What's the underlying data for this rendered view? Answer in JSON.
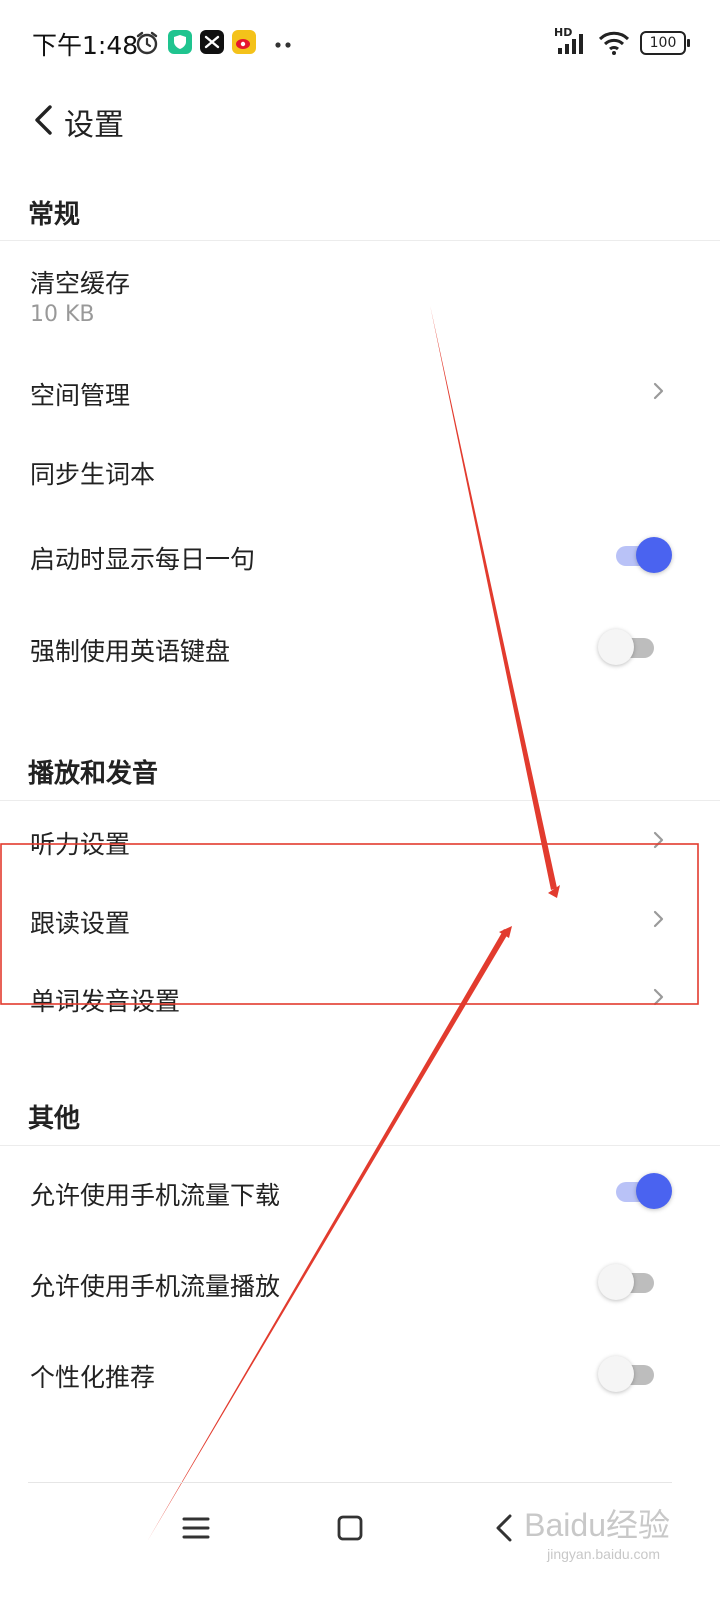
{
  "status_bar": {
    "time": "下午1:48",
    "app_icons": [
      "alarm-icon",
      "shield-app-icon",
      "capcut-app-icon",
      "weibo-app-icon",
      "more-dots-icon"
    ],
    "signal_label": "HD",
    "battery": "100"
  },
  "header": {
    "title": "设置"
  },
  "sections": {
    "general": {
      "title": "常规",
      "clear_cache": {
        "label": "清空缓存",
        "value": "10 KB"
      },
      "space_manage": {
        "label": "空间管理"
      },
      "sync_vocab": {
        "label": "同步生词本"
      },
      "daily_sentence": {
        "label": "启动时显示每日一句",
        "enabled": true
      },
      "force_english_keyboard": {
        "label": "强制使用英语键盘",
        "enabled": false
      }
    },
    "playback": {
      "title": "播放和发音",
      "listening": {
        "label": "听力设置"
      },
      "follow_read": {
        "label": "跟读设置"
      },
      "word_pronunciation": {
        "label": "单词发音设置"
      }
    },
    "other": {
      "title": "其他",
      "mobile_download": {
        "label": "允许使用手机流量下载",
        "enabled": true
      },
      "mobile_play": {
        "label": "允许使用手机流量播放",
        "enabled": false
      },
      "personalized": {
        "label": "个性化推荐",
        "enabled": false
      }
    }
  },
  "nav_bar": {
    "menu": "menu-icon",
    "home": "home-square-icon",
    "back": "back-chevron-icon"
  },
  "watermark": {
    "text": "Baidu经验",
    "sub": "jingyan.baidu.com"
  },
  "colors": {
    "accent": "#4a63f0",
    "annotation_red": "#e23b2e"
  }
}
